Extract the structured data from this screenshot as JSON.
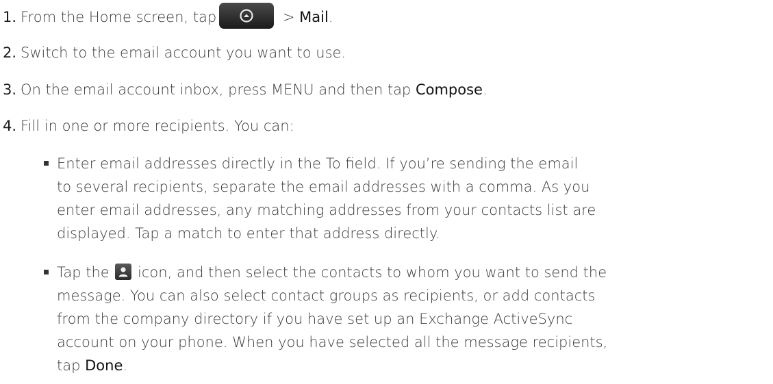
{
  "steps": [
    {
      "num": "1.",
      "pre": "From the Home screen, tap",
      "post": " > ",
      "bold": "Mail",
      "end": "."
    },
    {
      "num": "2.",
      "text": "Switch to the email account you want to use."
    },
    {
      "num": "3.",
      "pre": "On the email account inbox, press MENU and then tap ",
      "bold": "Compose",
      "end": "."
    },
    {
      "num": "4.",
      "text": "Fill in one or more recipients. You can:"
    }
  ],
  "bullets": [
    {
      "lines": [
        "Enter email addresses directly in the To field. If you’re sending the email",
        "to several recipients, separate the email addresses with a comma. As you",
        "enter email addresses, any matching addresses from your contacts list are",
        "displayed. Tap a match to enter that address directly."
      ]
    },
    {
      "line1_pre": "Tap the ",
      "line1_post": " icon, and then select the contacts to whom you want to send the",
      "lines": [
        "message. You can also select contact groups as recipients, or add contacts",
        "from the company directory if you have set up an Exchange ActiveSync",
        "account on your phone. When you have selected all the message recipients,"
      ],
      "last_pre": "tap ",
      "last_bold": "Done",
      "last_end": "."
    }
  ],
  "icons": {
    "home_button": "all-apps-up-arrow-icon",
    "contact_picker": "person-icon"
  }
}
